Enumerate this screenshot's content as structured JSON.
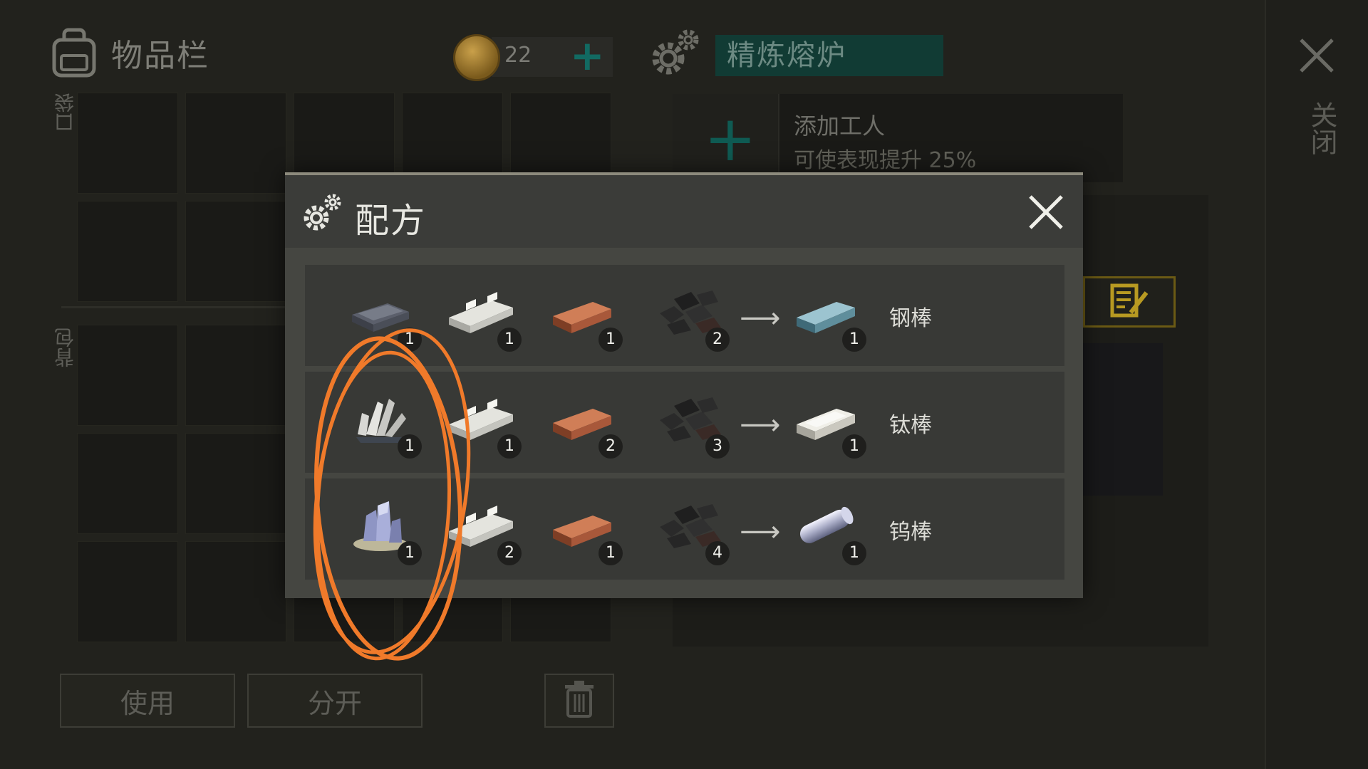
{
  "inventory": {
    "title": "物品栏",
    "pocket_label": "口袋",
    "backpack_label": "背包",
    "coins": "22",
    "use_button": "使用",
    "split_button": "分开"
  },
  "station": {
    "name": "精炼熔炉",
    "add_worker_title": "添加工人",
    "add_worker_desc": "可使表现提升 25%",
    "close_label": "关闭"
  },
  "recipe_modal": {
    "title": "配方",
    "arrow": "⟶",
    "recipes": [
      {
        "ingredients": [
          {
            "icon": "iron-ingot-icon",
            "qty": "1"
          },
          {
            "icon": "aluminum-bar-icon",
            "qty": "1"
          },
          {
            "icon": "copper-ingot-icon",
            "qty": "1"
          },
          {
            "icon": "coal-icon",
            "qty": "2"
          }
        ],
        "product": {
          "icon": "steel-bar-icon",
          "qty": "1",
          "name": "钢棒"
        }
      },
      {
        "ingredients": [
          {
            "icon": "titanium-ore-icon",
            "qty": "1"
          },
          {
            "icon": "aluminum-bar-icon",
            "qty": "1"
          },
          {
            "icon": "copper-ingot-icon",
            "qty": "2"
          },
          {
            "icon": "coal-icon",
            "qty": "3"
          }
        ],
        "product": {
          "icon": "titanium-bar-icon",
          "qty": "1",
          "name": "钛棒"
        }
      },
      {
        "ingredients": [
          {
            "icon": "tungsten-ore-icon",
            "qty": "1"
          },
          {
            "icon": "aluminum-bar-icon",
            "qty": "2"
          },
          {
            "icon": "copper-ingot-icon",
            "qty": "1"
          },
          {
            "icon": "coal-icon",
            "qty": "4"
          }
        ],
        "product": {
          "icon": "tungsten-rod-icon",
          "qty": "1",
          "name": "钨棒"
        }
      }
    ]
  },
  "colors": {
    "accent_teal": "#126a62",
    "annotation_orange": "#f07a2a",
    "modal_bg": "#454641"
  }
}
